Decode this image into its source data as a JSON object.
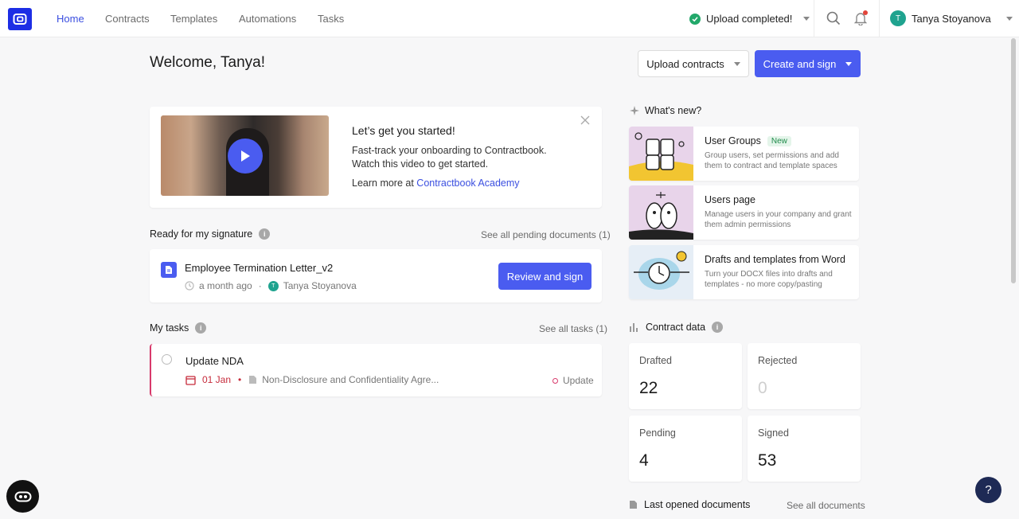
{
  "nav": {
    "items": [
      {
        "label": "Home"
      },
      {
        "label": "Contracts"
      },
      {
        "label": "Templates"
      },
      {
        "label": "Automations"
      },
      {
        "label": "Tasks"
      }
    ],
    "upload_status": "Upload completed!",
    "user_initial": "T",
    "user_name": "Tanya Stoyanova"
  },
  "header": {
    "welcome": "Welcome, Tanya!",
    "upload_button": "Upload contracts",
    "create_button": "Create and sign"
  },
  "onboarding": {
    "title": "Let’s get you started!",
    "line1": "Fast-track your onboarding to Contractbook.",
    "line2": "Watch this video to get started.",
    "learn_prefix": "Learn more at ",
    "learn_link": "Contractbook Academy"
  },
  "signature": {
    "title": "Ready for my signature",
    "see_all": "See all pending documents (1)",
    "doc_title": "Employee Termination Letter_v2",
    "time": "a month ago",
    "separator": "·",
    "owner_initial": "T",
    "owner": "Tanya Stoyanova",
    "action": "Review and sign"
  },
  "tasks": {
    "title": "My tasks",
    "see_all": "See all tasks (1)",
    "task_title": "Update NDA",
    "date": "01 Jan",
    "bullet": "•",
    "document": "Non-Disclosure and Confidentiality Agre...",
    "tag": "Update"
  },
  "whats_new": {
    "title": "What's new?",
    "items": [
      {
        "title": "User Groups",
        "badge": "New",
        "desc": "Group users, set permissions and add them to contract and template spaces"
      },
      {
        "title": "Users page",
        "desc": "Manage users in your company and grant them admin permissions"
      },
      {
        "title": "Drafts and templates from Word",
        "desc": "Turn your DOCX files into drafts and templates - no more copy/pasting"
      }
    ]
  },
  "contract_data": {
    "title": "Contract data",
    "stats": [
      {
        "label": "Drafted",
        "value": "22"
      },
      {
        "label": "Rejected",
        "value": "0"
      },
      {
        "label": "Pending",
        "value": "4"
      },
      {
        "label": "Signed",
        "value": "53"
      }
    ]
  },
  "last_opened": {
    "title": "Last opened documents",
    "see_all": "See all documents"
  },
  "help": {
    "label": "?"
  },
  "colors": {
    "accent": "#4a5cf0",
    "brand": "#1d2ee5",
    "success": "#22a86a",
    "task_accent": "#d8396b"
  }
}
